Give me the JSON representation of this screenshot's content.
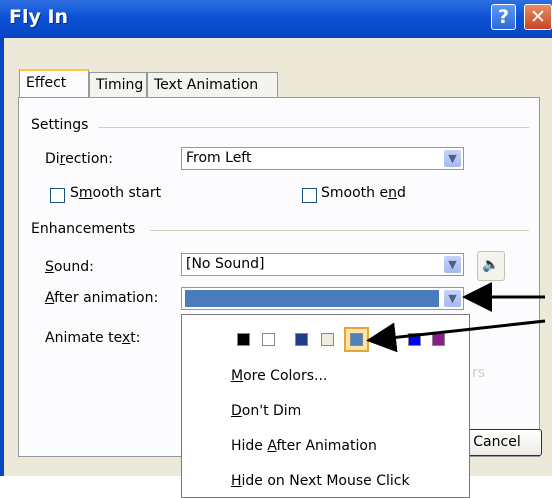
{
  "window": {
    "title": "Fly In",
    "help_btn": "?",
    "close_btn": "✕"
  },
  "tabs": [
    "Effect",
    "Timing",
    "Text Animation"
  ],
  "settings": {
    "group_label": "Settings",
    "direction_label": "Direction:",
    "direction_value": "From Left",
    "smooth_start": "Smooth start",
    "smooth_end": "Smooth end"
  },
  "enhancements": {
    "group_label": "Enhancements",
    "sound_label": "Sound:",
    "sound_value": "[No Sound]",
    "after_label": "After animation:",
    "animate_text_label": "Animate text:"
  },
  "color_dropdown": {
    "swatches": [
      "#000000",
      "#ffffff",
      "#1f3c88",
      "#f1ece0",
      "#4f81bd",
      "#0000ff",
      "#8b1c8c"
    ],
    "selected_swatch": "#4f81bd",
    "items": [
      "More Colors...",
      "Don't Dim",
      "Hide After Animation",
      "Hide on Next Mouse Click"
    ],
    "obscured_text": "rs"
  },
  "buttons": {
    "cancel": "Cancel"
  },
  "colors": {
    "selected_bar": "#4a7bbd",
    "titlebar": "#0a4fd4"
  }
}
